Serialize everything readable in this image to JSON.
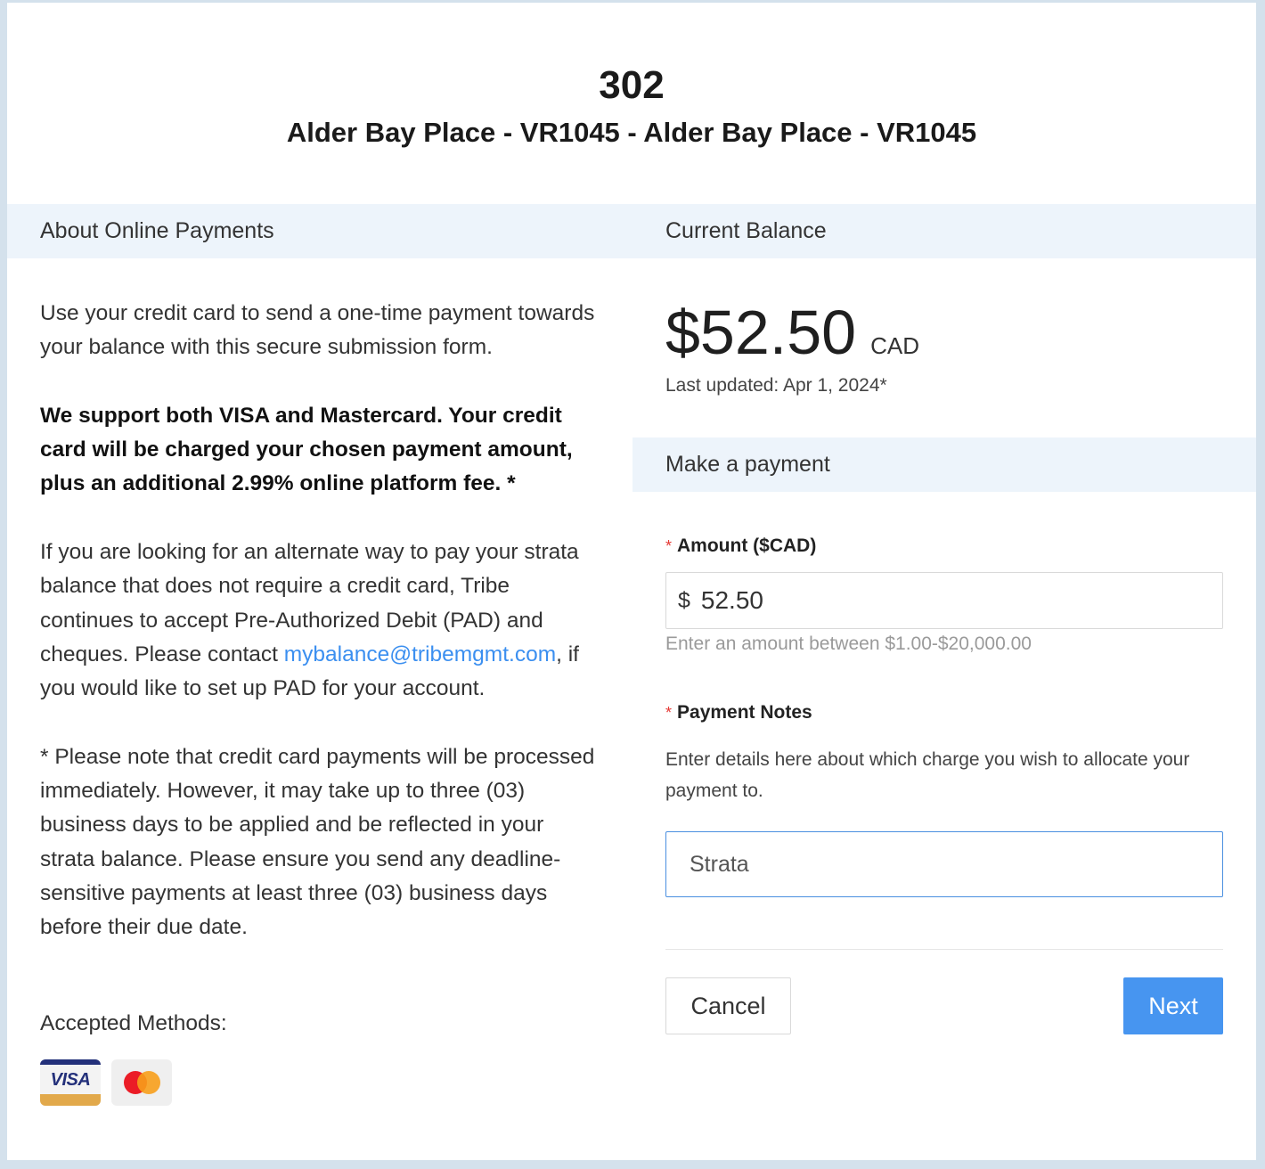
{
  "header": {
    "unit": "302",
    "property": "Alder Bay Place - VR1045 - Alder Bay Place - VR1045"
  },
  "about": {
    "heading": "About Online Payments",
    "intro": "Use your credit card to send a one-time payment towards your balance with this secure submission form.",
    "support": "We support both VISA and Mastercard. Your credit card will be charged your chosen payment amount, plus an additional 2.99% online platform fee. *",
    "alternate_before": "If you are looking for an alternate way to pay your strata balance that does not require a credit card, Tribe continues to accept Pre-Authorized Debit (PAD) and cheques. Please contact ",
    "alternate_email": "mybalance@tribemgmt.com",
    "alternate_after": ", if you would like to set up PAD for your account.",
    "note": "* Please note that credit card payments will be processed immediately. However, it may take up to three (03) business days to be applied and be reflected in your strata balance. Please ensure you send any deadline-sensitive payments at least three (03) business days before their due date.",
    "methods_label": "Accepted Methods:",
    "methods": [
      {
        "name": "VISA",
        "icon": "visa-card-icon"
      },
      {
        "name": "Mastercard",
        "icon": "mastercard-icon"
      }
    ]
  },
  "balance": {
    "heading": "Current Balance",
    "amount": "$52.50",
    "currency": "CAD",
    "last_updated": "Last updated: Apr 1, 2024*"
  },
  "payment": {
    "heading": "Make a payment",
    "amount_label": "Amount ($CAD)",
    "required_mark": "*",
    "amount_prefix": "$",
    "amount_value": "52.50",
    "amount_hint": "Enter an amount between $1.00-$20,000.00",
    "notes_label": "Payment Notes",
    "notes_help": "Enter details here about which charge you wish to allocate your payment to.",
    "notes_value": "Strata",
    "cancel_label": "Cancel",
    "next_label": "Next"
  },
  "colors": {
    "page_bg": "#d4e1ec",
    "section_bar": "#edf4fb",
    "link": "#3b8ff0",
    "primary": "#4795f0",
    "required": "#e53935"
  }
}
